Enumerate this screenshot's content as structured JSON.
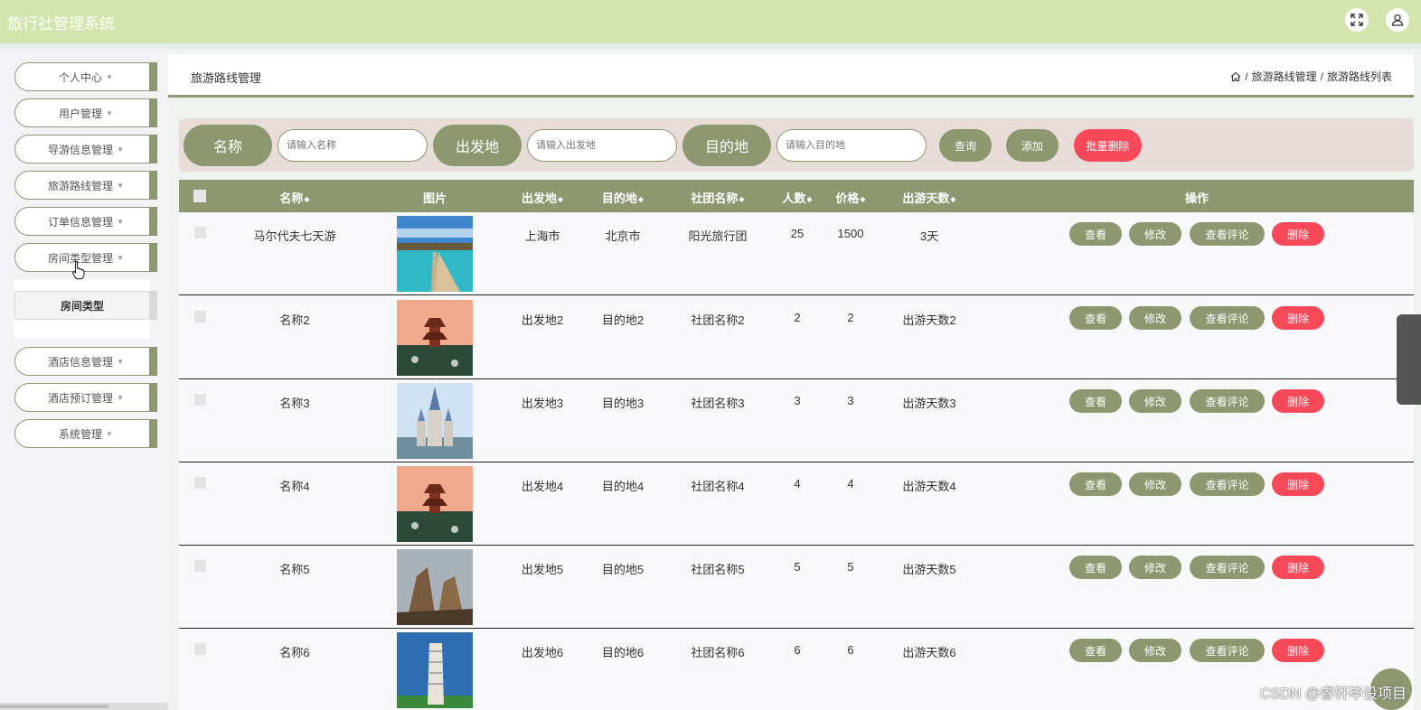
{
  "app": {
    "title": "旅行社管理系统"
  },
  "colors": {
    "accent": "#8d9871",
    "topbar": "#d4e4ad",
    "danger": "#f74959",
    "search_bg": "#e8dcd9"
  },
  "sidebar": {
    "items": [
      {
        "label": "个人中心"
      },
      {
        "label": "用户管理"
      },
      {
        "label": "导游信息管理"
      },
      {
        "label": "旅游路线管理"
      },
      {
        "label": "订单信息管理"
      },
      {
        "label": "房间类型管理"
      },
      {
        "label": "酒店信息管理"
      },
      {
        "label": "酒店预订管理"
      },
      {
        "label": "系统管理"
      }
    ],
    "submenu": {
      "label": "房间类型"
    }
  },
  "header": {
    "title": "旅游路线管理",
    "breadcrumb": [
      "旅游路线管理",
      "旅游路线列表"
    ]
  },
  "search": {
    "name_label": "名称",
    "name_placeholder": "请输入名称",
    "origin_label": "出发地",
    "origin_placeholder": "请输入出发地",
    "dest_label": "目的地",
    "dest_placeholder": "请输入目的地",
    "query_button": "查询",
    "add_button": "添加",
    "batch_delete_button": "批量删除"
  },
  "table": {
    "headers": {
      "name": "名称",
      "image": "图片",
      "origin": "出发地",
      "dest": "目的地",
      "group": "社团名称",
      "people": "人数",
      "price": "价格",
      "days": "出游天数",
      "actions": "操作"
    },
    "actions": {
      "view": "查看",
      "edit": "修改",
      "review": "查看评论",
      "delete": "删除"
    },
    "rows": [
      {
        "name": "马尔代夫七天游",
        "image": "beach-pier",
        "origin": "上海市",
        "dest": "北京市",
        "group": "阳光旅行团",
        "people": "25",
        "price": "1500",
        "days": "3天"
      },
      {
        "name": "名称2",
        "image": "pagoda",
        "origin": "出发地2",
        "dest": "目的地2",
        "group": "社团名称2",
        "people": "2",
        "price": "2",
        "days": "出游天数2"
      },
      {
        "name": "名称3",
        "image": "castle",
        "origin": "出发地3",
        "dest": "目的地3",
        "group": "社团名称3",
        "people": "3",
        "price": "3",
        "days": "出游天数3"
      },
      {
        "name": "名称4",
        "image": "pagoda",
        "origin": "出发地4",
        "dest": "目的地4",
        "group": "社团名称4",
        "people": "4",
        "price": "4",
        "days": "出游天数4"
      },
      {
        "name": "名称5",
        "image": "rock-mountain",
        "origin": "出发地5",
        "dest": "目的地5",
        "group": "社团名称5",
        "people": "5",
        "price": "5",
        "days": "出游天数5"
      },
      {
        "name": "名称6",
        "image": "leaning-tower",
        "origin": "出发地6",
        "dest": "目的地6",
        "group": "社团名称6",
        "people": "6",
        "price": "6",
        "days": "出游天数6"
      }
    ]
  },
  "watermark": "CSDN @睿轩毕设项目"
}
